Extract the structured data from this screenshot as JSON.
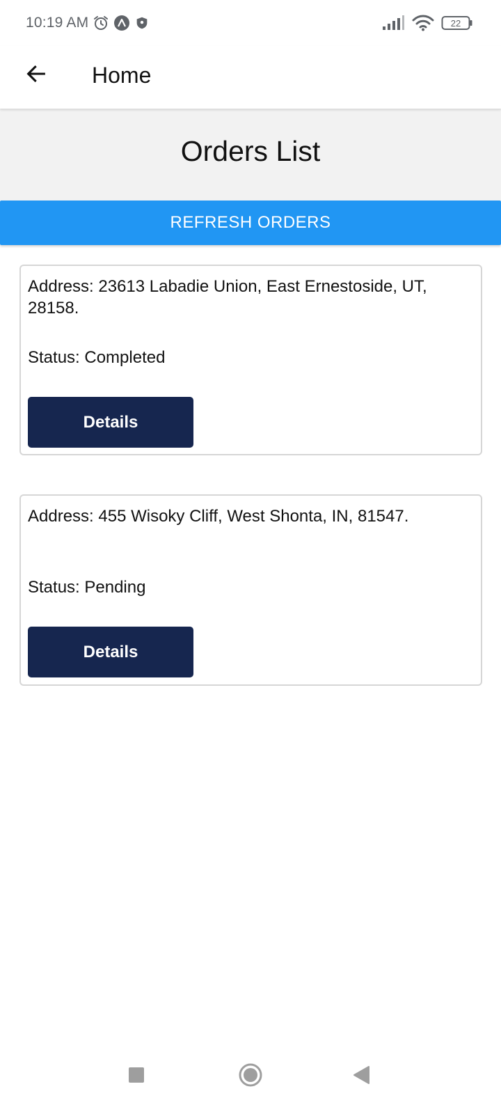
{
  "status_bar": {
    "time": "10:19 AM",
    "left_icons": [
      "alarm-icon",
      "app-notification-icon",
      "shield-icon"
    ],
    "right_icons": [
      "signal-icon",
      "wifi-icon",
      "battery-icon"
    ],
    "battery_level": "22"
  },
  "app_bar": {
    "back_icon": "arrow-left-icon",
    "title": "Home"
  },
  "page": {
    "title": "Orders List",
    "refresh_label": "REFRESH ORDERS",
    "refresh_color": "#2196f3"
  },
  "orders": [
    {
      "address": "Address: 23613 Labadie Union, East Ernestoside, UT, 28158.",
      "status": "Status: Completed",
      "details_label": "Details"
    },
    {
      "address": "Address: 455 Wisoky Cliff, West Shonta, IN, 81547.",
      "status": "Status: Pending",
      "details_label": "Details"
    }
  ],
  "colors": {
    "details_button": "#16264f",
    "header_band": "#f2f2f2"
  },
  "nav_bar": {
    "items": [
      "recents-square-icon",
      "home-circle-icon",
      "back-triangle-icon"
    ]
  }
}
